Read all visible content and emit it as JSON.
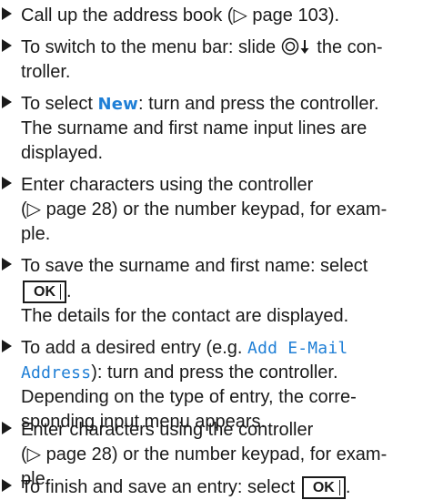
{
  "steps": [
    {
      "lines": [
        "Call up the address book (▷ page 103)."
      ]
    },
    {
      "lines": [
        "To switch to the menu bar: slide",
        "the con-",
        "troller."
      ]
    },
    {
      "lines": [
        "To select",
        "New",
        ": turn and press the controller.",
        "The surname and first name input lines are",
        "displayed."
      ]
    },
    {
      "lines": [
        "Enter characters using the controller",
        "(▷ page 28) or the number keypad, for exam-",
        "ple."
      ]
    },
    {
      "lines": [
        "To save the surname and first name: select",
        "OK",
        ".",
        "The details for the contact are displayed."
      ]
    },
    {
      "lines": [
        "To add a desired entry (e.g.",
        "Add E-Mail",
        "Address",
        "): turn and press the controller.",
        "Depending on the type of entry, the corre-",
        "sponding input menu appears."
      ]
    },
    {
      "lines": [
        "Enter characters using the controller",
        "(▷ page 28) or the number keypad, for exam-",
        "ple."
      ]
    },
    {
      "lines": [
        "To finish and save an entry: select",
        "OK",
        "."
      ]
    }
  ],
  "colors": {
    "ui_term": "#1f7fd6",
    "text": "#1a1a1a"
  }
}
